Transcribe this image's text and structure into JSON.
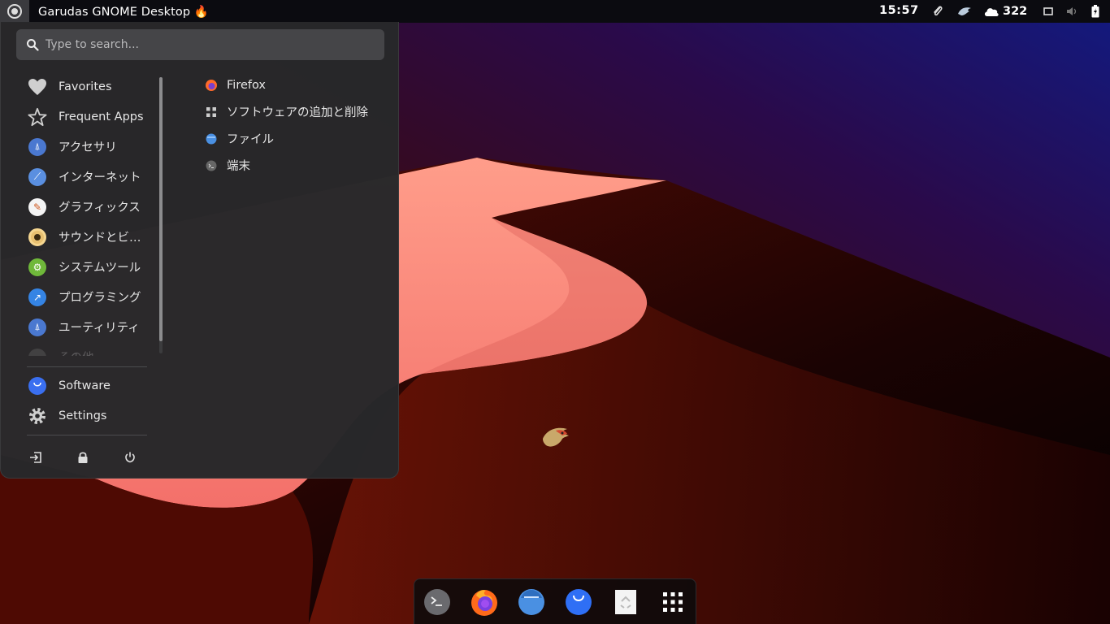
{
  "colors": {
    "accent": "#3584e4",
    "panel": "#28282a",
    "topbar": "#0b0b10"
  },
  "topbar": {
    "app_title": "Garudas GNOME Desktop 🔥",
    "clock": "15:57",
    "weather_temp": "322",
    "icons": [
      "activities-icon",
      "paperclip-icon",
      "garuda-icon",
      "weather-icon",
      "screen-icon",
      "volume-icon",
      "battery-icon"
    ]
  },
  "menu": {
    "search_placeholder": "Type to search...",
    "categories": [
      {
        "label": "Favorites",
        "icon": "heart-icon"
      },
      {
        "label": "Frequent Apps",
        "icon": "star-icon"
      },
      {
        "label": "アクセサリ",
        "icon": "accessories-icon"
      },
      {
        "label": "インターネット",
        "icon": "internet-icon"
      },
      {
        "label": "グラフィックス",
        "icon": "graphics-icon"
      },
      {
        "label": "サウンドとビ…",
        "icon": "sound-video-icon"
      },
      {
        "label": "システムツール",
        "icon": "system-tools-icon"
      },
      {
        "label": "プログラミング",
        "icon": "programming-icon"
      },
      {
        "label": "ユーティリティ",
        "icon": "utilities-icon"
      },
      {
        "label": "その他",
        "icon": "other-icon"
      }
    ],
    "bottom": [
      {
        "label": "Software",
        "icon": "software-icon"
      },
      {
        "label": "Settings",
        "icon": "gear-icon"
      }
    ],
    "session": [
      "logout-icon",
      "lock-icon",
      "power-icon"
    ],
    "apps": [
      {
        "label": "Firefox",
        "icon": "firefox-icon"
      },
      {
        "label": "ソフトウェアの追加と削除",
        "icon": "grid-icon"
      },
      {
        "label": "ファイル",
        "icon": "files-icon"
      },
      {
        "label": "端末",
        "icon": "terminal-icon"
      }
    ]
  },
  "dock": {
    "items": [
      "terminal-icon",
      "firefox-icon",
      "files-icon",
      "software-icon",
      "trash-icon",
      "show-apps-icon"
    ]
  }
}
